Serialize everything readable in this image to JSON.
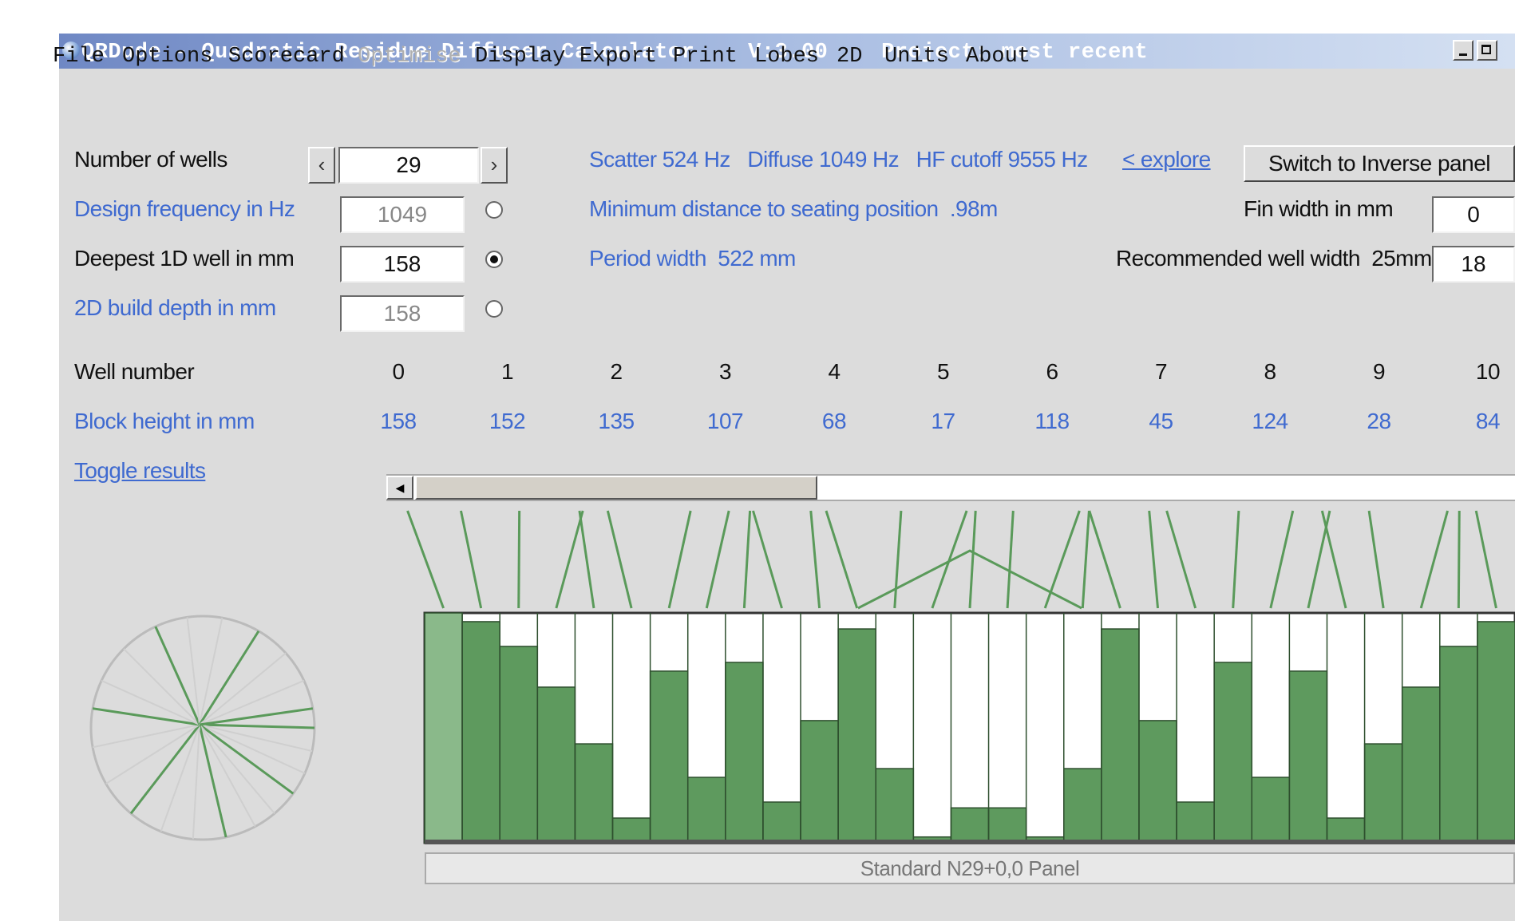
{
  "window": {
    "title": "QRDude - Quadratic Residue Diffuser Calculator    V:3.00    Project: most recent"
  },
  "menu": {
    "items": [
      "File",
      "Options",
      "Scorecard",
      "Optimise",
      "Display",
      "Export",
      "Print",
      "Lobes",
      "2D",
      "Units",
      "About"
    ],
    "disabled": [
      "Optimise"
    ]
  },
  "form": {
    "wells_label": "Number of wells",
    "wells_value": "29",
    "design_freq_label": "Design frequency in Hz",
    "design_freq_value": "1049",
    "deepest_label": "Deepest 1D well in mm",
    "deepest_value": "158",
    "build_depth_label": "2D build depth in mm",
    "build_depth_value": "158",
    "selected_radio": "deepest"
  },
  "info": {
    "freq_line": "Scatter 524 Hz   Diffuse 1049 Hz   HF cutoff 9555 Hz",
    "explore_link": "< explore",
    "min_distance": "Minimum distance to seating position  .98m",
    "period_width": "Period width  522 mm",
    "switch_button": "Switch to Inverse panel",
    "fin_label": "Fin width in mm",
    "fin_value": "0",
    "recommended_label": "Recommended well width  25mm",
    "recommended_value": "18"
  },
  "results": {
    "well_number_label": "Well number",
    "block_height_label": "Block height in mm",
    "toggle_link": "Toggle results",
    "well_numbers": [
      "0",
      "1",
      "2",
      "3",
      "4",
      "5",
      "6",
      "7",
      "8",
      "9",
      "10"
    ],
    "block_heights": [
      "158",
      "152",
      "135",
      "107",
      "68",
      "17",
      "118",
      "45",
      "124",
      "28",
      "84"
    ]
  },
  "panel": {
    "caption": "Standard N29+0,0 Panel",
    "well_count": 29,
    "depths_mm": [
      0,
      6,
      23,
      51,
      90,
      141,
      40,
      113,
      34,
      130,
      74,
      11,
      107,
      154,
      134,
      134,
      154,
      107,
      11,
      74,
      130,
      34,
      113,
      40,
      141,
      90,
      51,
      23,
      6
    ],
    "max_depth_mm": 158,
    "colors": {
      "fill": "#5e9a5e",
      "fill_light": "#8ab98a",
      "empty": "#ffffff",
      "scatter_line": "#5a9a5a",
      "polar_circle": "#bbbbbb"
    }
  }
}
